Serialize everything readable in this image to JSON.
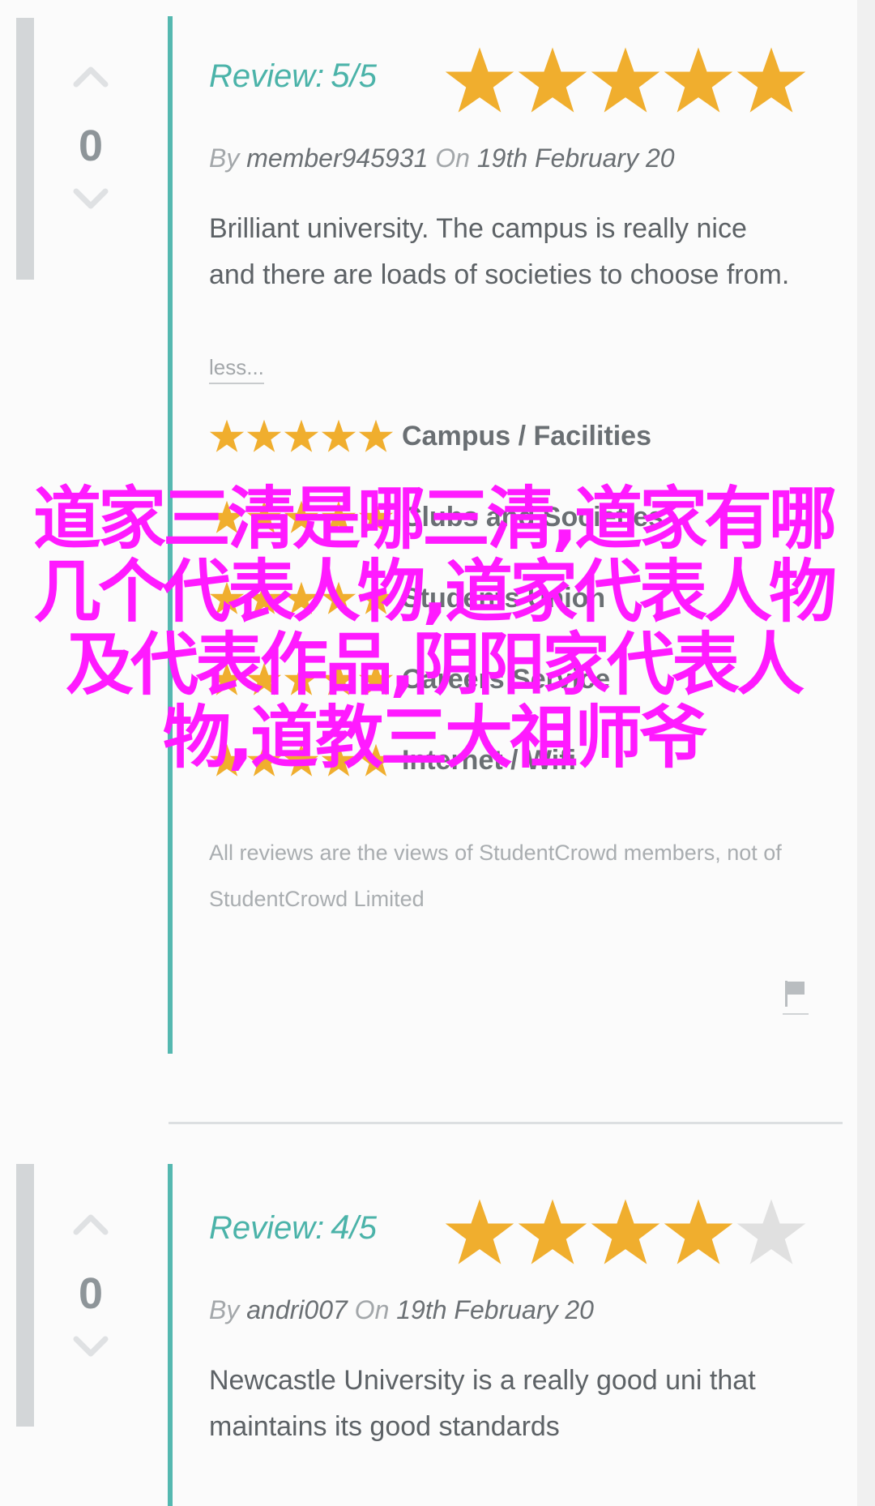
{
  "reviews": [
    {
      "votes": {
        "up_icon": "chevron-up-icon",
        "count": "0",
        "down_icon": "chevron-down-icon"
      },
      "rating": {
        "label": "Review:",
        "score": "5",
        "out_of": "/5",
        "stars_filled": 5,
        "stars_total": 5
      },
      "meta": {
        "by_label": "By",
        "author": "member945931",
        "on_label": "On",
        "date": "19th February 20"
      },
      "body": "Brilliant university. The campus is really nice and there are loads of societies to choose from.",
      "less_label": "less...",
      "categories": [
        {
          "label": "Campus / Facilities",
          "stars": 5
        },
        {
          "label": "Clubs and Societies",
          "stars": 5
        },
        {
          "label": "Students Union",
          "stars": 5
        },
        {
          "label": "Careers Service",
          "stars": 5
        },
        {
          "label": "Internet / Wifi",
          "stars": 5
        }
      ],
      "disclaimer": "All reviews are the views of StudentCrowd members, not of StudentCrowd Limited",
      "flag_icon": "flag-icon"
    },
    {
      "votes": {
        "up_icon": "chevron-up-icon",
        "count": "0",
        "down_icon": "chevron-down-icon"
      },
      "rating": {
        "label": "Review:",
        "score": "4",
        "out_of": "/5",
        "stars_filled": 4,
        "stars_total": 5
      },
      "meta": {
        "by_label": "By",
        "author": "andri007",
        "on_label": "On",
        "date": "19th February 20"
      },
      "body": "Newcastle University is a really good uni that maintains its good standards"
    }
  ],
  "overlay_text": "道家三清是哪三清,道家有哪几个代表人物,道家代表人物及代表作品,阴阳家代表人物,道教三大祖师爷",
  "colors": {
    "teal": "#4bb3a9",
    "star_filled": "#f0ae2e",
    "star_empty": "#e0e0e0",
    "overlay": "#ff1aff",
    "vote_bar": "#d3d6d8"
  }
}
